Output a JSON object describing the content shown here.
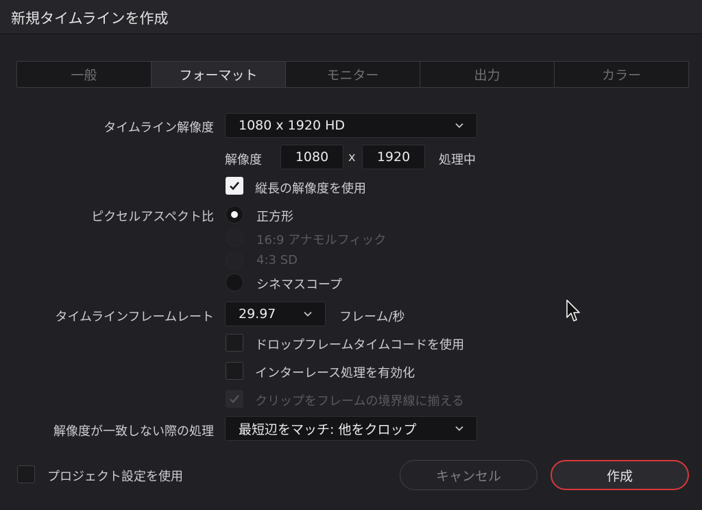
{
  "dialog": {
    "title": "新規タイムラインを作成"
  },
  "tabs": [
    {
      "label": "一般",
      "active": false
    },
    {
      "label": "フォーマット",
      "active": true
    },
    {
      "label": "モニター",
      "active": false
    },
    {
      "label": "出力",
      "active": false
    },
    {
      "label": "カラー",
      "active": false
    }
  ],
  "format": {
    "resolution_label": "タイムライン解像度",
    "resolution_value": "1080 x 1920 HD",
    "custom_label": "解像度",
    "width": "1080",
    "x_sep": "x",
    "height": "1920",
    "processing": "処理中",
    "vertical_label": "縦長の解像度を使用",
    "vertical_checked": true,
    "aspect_label": "ピクセルアスペクト比",
    "aspect_options": [
      {
        "label": "正方形",
        "selected": true,
        "enabled": true
      },
      {
        "label": "16:9 アナモルフィック",
        "selected": false,
        "enabled": false
      },
      {
        "label": "4:3 SD",
        "selected": false,
        "enabled": false
      },
      {
        "label": "シネマスコープ",
        "selected": false,
        "enabled": true
      }
    ],
    "framerate_label": "タイムラインフレームレート",
    "framerate_value": "29.97",
    "framerate_unit": "フレーム/秒",
    "dropframe_label": "ドロップフレームタイムコードを使用",
    "dropframe_checked": false,
    "interlace_label": "インターレース処理を有効化",
    "interlace_checked": false,
    "conform_label": "クリップをフレームの境界線に揃える",
    "conform_checked": true,
    "conform_enabled": false,
    "mismatch_label": "解像度が一致しない際の処理",
    "mismatch_value": "最短辺をマッチ: 他をクロップ"
  },
  "footer": {
    "project_settings_label": "プロジェクト設定を使用",
    "cancel_label": "キャンセル",
    "create_label": "作成"
  },
  "colors": {
    "accent": "#d8383a",
    "background": "#212125"
  }
}
